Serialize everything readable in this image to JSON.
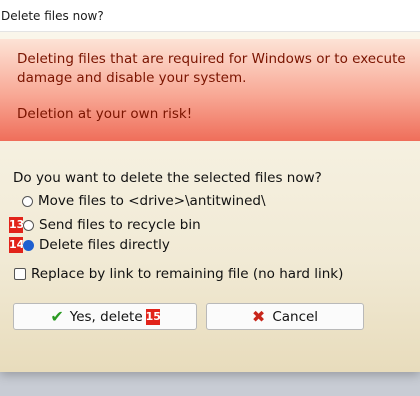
{
  "window": {
    "title": "Delete files now?"
  },
  "warning": {
    "line1": "Deleting files that are required for Windows or to execute",
    "line2": "damage and disable your system.",
    "line3": "Deletion at your own risk!"
  },
  "question": "Do you want to delete the selected files now?",
  "options": [
    {
      "label": "Move files to <drive>\\antitwined\\",
      "selected": false,
      "badge": ""
    },
    {
      "label": "Send files to recycle bin",
      "selected": false,
      "badge": "13"
    },
    {
      "label": "Delete files directly",
      "selected": true,
      "badge": "14"
    }
  ],
  "checkbox": {
    "label": "Replace by link to remaining file (no hard link)",
    "checked": false
  },
  "buttons": {
    "yes_label": "Yes, delete",
    "yes_badge": "15",
    "cancel_label": "Cancel"
  },
  "icons": {
    "yes": "checkmark-icon",
    "cancel": "x-mark-icon"
  },
  "colors": {
    "badge": "#e2231a",
    "warning_text": "#7a1400",
    "radio_selected": "#1f5fd0"
  }
}
